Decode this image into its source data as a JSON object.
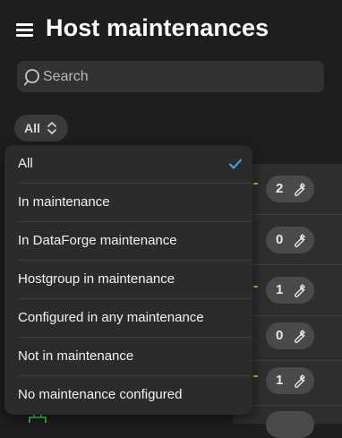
{
  "header": {
    "title": "Host maintenances",
    "menu_icon": "hamburger-menu-icon"
  },
  "search": {
    "placeholder": "Search",
    "value": "",
    "icon": "search-icon"
  },
  "filter": {
    "selected_label": "All",
    "chevron_icon": "chevron-up-down-icon"
  },
  "dropdown": {
    "options": [
      {
        "label": "All",
        "selected": true
      },
      {
        "label": "In maintenance",
        "selected": false
      },
      {
        "label": "In DataForge maintenance",
        "selected": false
      },
      {
        "label": "Hostgroup in maintenance",
        "selected": false
      },
      {
        "label": "Configured in any maintenance",
        "selected": false
      },
      {
        "label": "Not in maintenance",
        "selected": false
      },
      {
        "label": "No maintenance configured",
        "selected": false
      }
    ],
    "check_icon": "checkmark-icon",
    "check_color": "#4aa3f0"
  },
  "background_list": {
    "counts": [
      "2",
      "0",
      "1",
      "0",
      "1"
    ],
    "item_icon": "wrench-icon"
  },
  "colors": {
    "background": "#1e1e1e",
    "dropdown": "#2b2b2b",
    "accent_check": "#4aa3f0",
    "indicator": "#d9b048"
  }
}
